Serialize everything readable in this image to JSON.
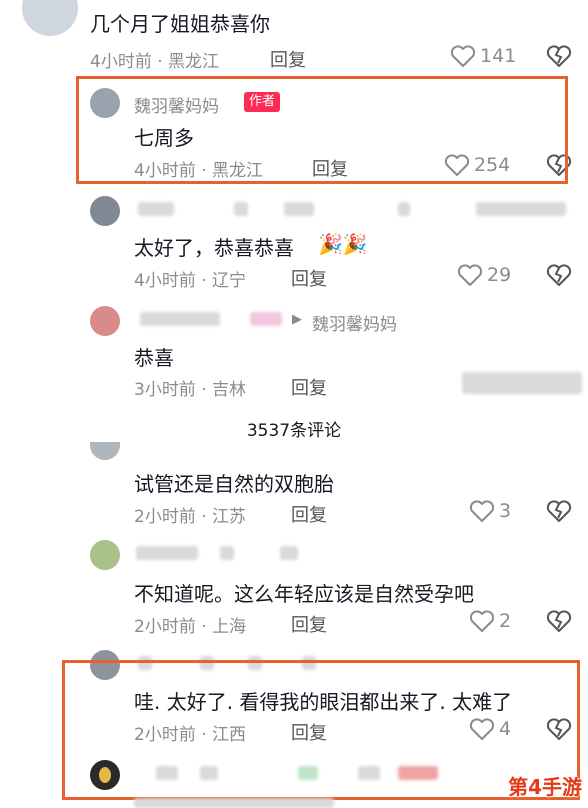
{
  "comments": [
    {
      "text": "几个月了姐姐恭喜你",
      "time": "4小时前 · 黑龙江",
      "reply": "回复",
      "likes": "141"
    },
    {
      "user": "魏羽馨妈妈",
      "badge": "作者",
      "text": "七周多",
      "time": "4小时前 · 黑龙江",
      "reply": "回复",
      "likes": "254"
    },
    {
      "text": "太好了，恭喜恭喜",
      "time": "4小时前 · 辽宁",
      "reply": "回复",
      "likes": "29"
    },
    {
      "reply_to": "魏羽馨妈妈",
      "text": "恭喜",
      "time": "3小时前 · 吉林",
      "reply": "回复"
    },
    {
      "text": "试管还是自然的双胞胎",
      "time": "2小时前 · 江苏",
      "reply": "回复",
      "likes": "3"
    },
    {
      "text": "不知道呢。这么年轻应该是自然受孕吧",
      "time": "2小时前 · 上海",
      "reply": "回复",
      "likes": "2"
    },
    {
      "text": "哇. 太好了. 看得我的眼泪都出来了. 太难了",
      "time": "2小时前 · 江西",
      "reply": "回复",
      "likes": "4"
    }
  ],
  "comment_count": "3537条评论",
  "watermark": "第4手游",
  "colors": {
    "highlight": "#e8612d",
    "badge": "#fe2c55"
  },
  "icons": {
    "like": "heart-outline-icon",
    "dislike": "broken-heart-icon",
    "reply_arrow": "triangle-right-icon"
  }
}
